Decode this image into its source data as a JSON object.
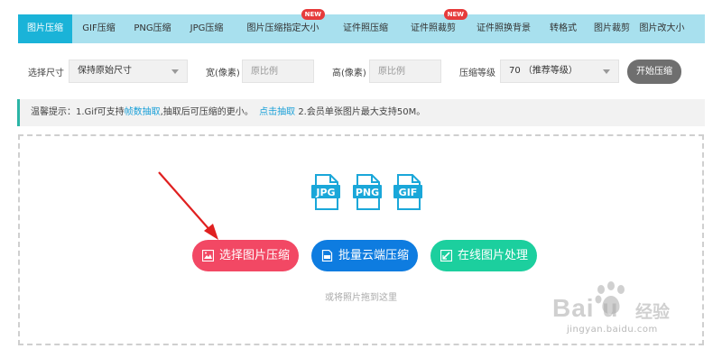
{
  "tabs": [
    {
      "label": "图片压缩",
      "active": true
    },
    {
      "label": "GIF压缩"
    },
    {
      "label": "PNG压缩"
    },
    {
      "label": "JPG压缩"
    },
    {
      "label": "图片压缩指定大小",
      "badge": "NEW"
    },
    {
      "label": "证件照压缩"
    },
    {
      "label": "证件照裁剪",
      "badge": "NEW"
    },
    {
      "label": "证件照换背景"
    },
    {
      "label": "转格式"
    },
    {
      "label": "图片裁剪"
    },
    {
      "label": "图片改大小"
    }
  ],
  "options": {
    "size_label": "选择尺寸",
    "size_value": "保持原始尺寸",
    "width_label": "宽(像素)",
    "width_placeholder": "原比例",
    "height_label": "高(像素)",
    "height_placeholder": "原比例",
    "level_label": "压缩等级",
    "level_value": "70 （推荐等级）",
    "start_button": "开始压缩"
  },
  "notice": {
    "prefix": "温馨提示：1.Gif可支持",
    "link1": "帧数抽取",
    "middle": ",抽取后可压缩的更小。",
    "link2": "点击抽取",
    "suffix": " 2.会员单张图片最大支持50M。"
  },
  "file_types": [
    "JPG",
    "PNG",
    "GIF"
  ],
  "buttons": {
    "select": "选择图片压缩",
    "batch": "批量云端压缩",
    "online": "在线图片处理"
  },
  "drop_hint": "或将照片拖到这里",
  "watermark": {
    "logo": "Bai  u",
    "sub": "经验",
    "url": "jingyan.baidu.com"
  },
  "colors": {
    "accent": "#1ab3d8",
    "tab_bar": "#a8e0ee",
    "select_button": "#f24864",
    "batch_button": "#0e7ce0",
    "online_button": "#1ccf9e",
    "arrow": "#e02020"
  }
}
